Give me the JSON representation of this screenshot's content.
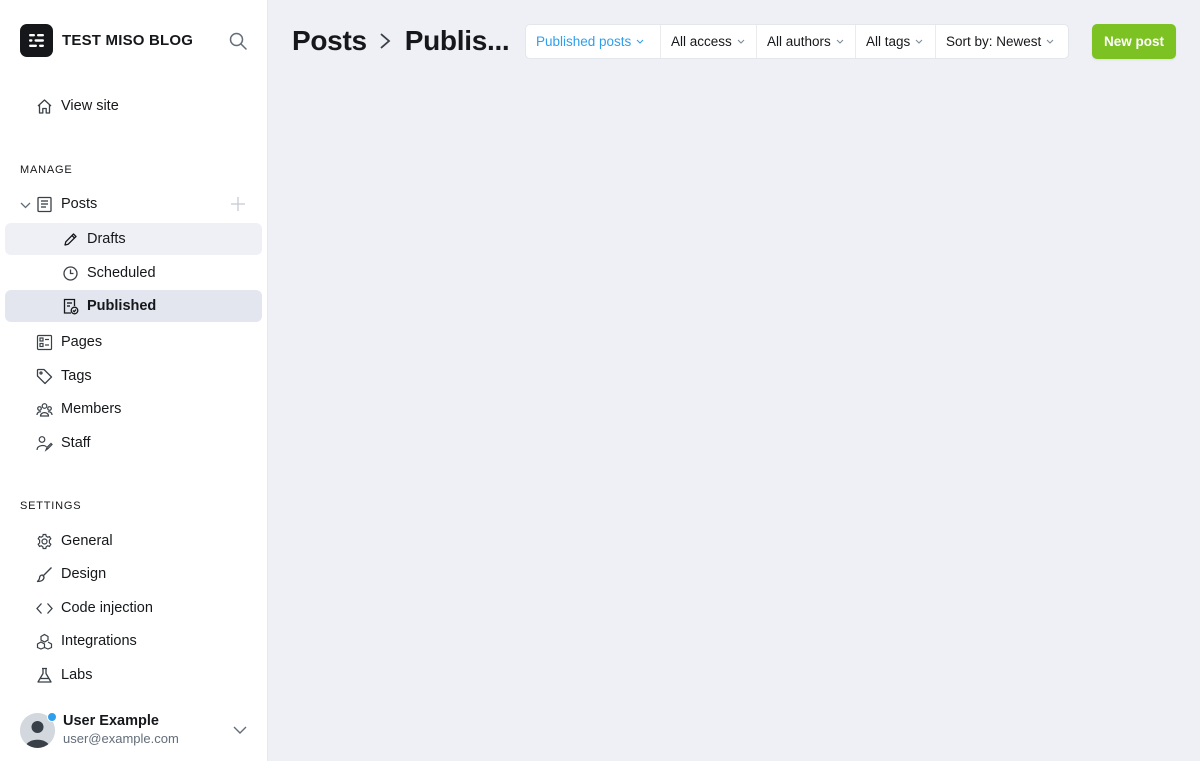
{
  "brand": {
    "title": "TEST MISO BLOG",
    "logo_icon": "ghost-logo-icon"
  },
  "sidebar": {
    "view_site": "View site",
    "manage_label": "MANAGE",
    "posts": {
      "label": "Posts",
      "children": [
        {
          "label": "Drafts",
          "icon": "pencil-icon"
        },
        {
          "label": "Scheduled",
          "icon": "clock-icon"
        },
        {
          "label": "Published",
          "icon": "published-icon"
        }
      ]
    },
    "manage_items": [
      {
        "label": "Pages",
        "icon": "pages-icon"
      },
      {
        "label": "Tags",
        "icon": "tag-icon"
      },
      {
        "label": "Members",
        "icon": "members-icon"
      },
      {
        "label": "Staff",
        "icon": "staff-icon"
      }
    ],
    "settings_label": "SETTINGS",
    "settings_items": [
      {
        "label": "General",
        "icon": "gear-icon"
      },
      {
        "label": "Design",
        "icon": "brush-icon"
      },
      {
        "label": "Code injection",
        "icon": "code-icon"
      },
      {
        "label": "Integrations",
        "icon": "integrations-icon"
      },
      {
        "label": "Labs",
        "icon": "flask-icon"
      }
    ]
  },
  "user": {
    "name": "User Example",
    "email": "user@example.com"
  },
  "header": {
    "breadcrumb_root": "Posts",
    "breadcrumb_current": "Publis...",
    "filters": [
      {
        "label": "Published posts",
        "active": true
      },
      {
        "label": "All access"
      },
      {
        "label": "All authors"
      },
      {
        "label": "All tags"
      },
      {
        "label": "Sort by: Newest"
      }
    ],
    "new_post_label": "New post"
  },
  "colors": {
    "accent": "#2f9fec",
    "primary_button": "#7cc222",
    "active_nav_bg": "#e3e6ef",
    "canvas_bg": "#eff0f5"
  }
}
